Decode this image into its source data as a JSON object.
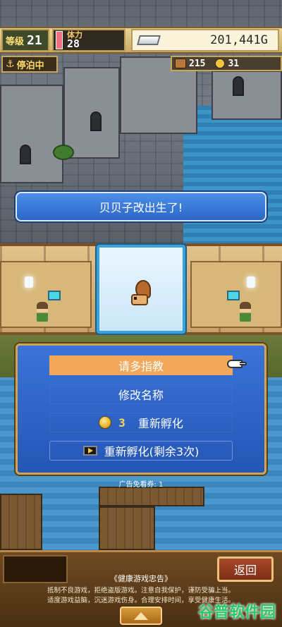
{
  "hud": {
    "level_label": "等级",
    "level_value": "21",
    "stamina_label": "体力",
    "stamina_value": "28",
    "gold_value": "201,441G",
    "docked_label": "停泊中",
    "wood_value": "215",
    "coin_value": "31"
  },
  "banner": {
    "text": "贝贝子改出生了!"
  },
  "menu": {
    "items": [
      {
        "label": "请多指教"
      },
      {
        "label": "修改名称"
      },
      {
        "label": "重新孵化",
        "cost": "3"
      },
      {
        "label": "重新孵化(剩余3次)"
      }
    ]
  },
  "ad_coupons_text": "广告免看券: 1",
  "bottom": {
    "return_label": "返回",
    "advisory_title": "《健康游戏忠告》",
    "advisory_line1": "抵制不良游戏，拒绝盗版游戏。注意自我保护，谨防受骗上当。",
    "advisory_line2": "适度游戏益脑，沉迷游戏伤身。合理安排时间，享受健康生活。"
  },
  "watermark_text": "谷普软件园",
  "colors": {
    "menu_bg": "#2d62c4",
    "menu_selected": "#f2a85b",
    "banner_bg": "#3a7ad8",
    "gold_border": "#c9a659"
  },
  "icons": [
    "anchor-icon",
    "gold-bar-icon",
    "wood-icon",
    "coin-icon",
    "pointer-hand-icon",
    "video-ad-icon",
    "triangle-up-icon"
  ]
}
